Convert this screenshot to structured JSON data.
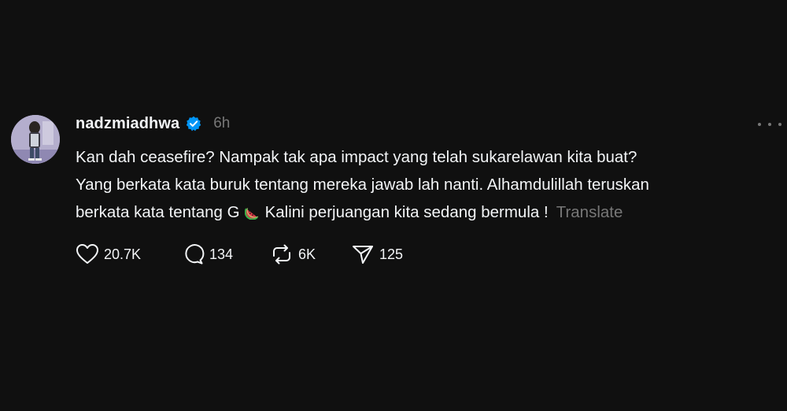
{
  "post": {
    "author": {
      "username": "nadzmiadhwa",
      "verified": true,
      "avatar_icon": "avatar-photo"
    },
    "time": "6h",
    "more_icon": "more-horizontal-icon",
    "text_lines": [
      "Kan dah ceasefire? Nampak tak apa impact yang telah sukarelawan kita buat?",
      "Yang berkata kata buruk tentang mereka jawab lah nanti. Alhamdulillah teruskan",
      "berkata kata tentang G",
      "Kalini perjuangan kita sedang bermula !"
    ],
    "emoji_icon": "watermelon-icon",
    "translate_label": "Translate",
    "stats": {
      "likes": "20.7K",
      "replies": "134",
      "reposts": "6K",
      "shares": "125"
    }
  },
  "colors": {
    "background": "#101010",
    "text_primary": "#f3f5f7",
    "text_secondary": "#777777",
    "verified_badge": "#0095f6"
  }
}
